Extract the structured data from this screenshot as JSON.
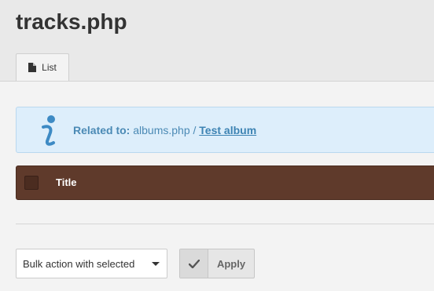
{
  "page": {
    "title": "tracks.php"
  },
  "tabs": [
    {
      "label": "List",
      "icon": "document-icon",
      "active": true
    }
  ],
  "info": {
    "label": "Related to:",
    "parent_file": "albums.php",
    "separator": "/",
    "parent_link": "Test album",
    "icon": "info-icon",
    "color": "#4b8ab5"
  },
  "table": {
    "columns": [
      "Title"
    ],
    "header_color": "#5f3a2b"
  },
  "bulk": {
    "selected": "Bulk action with selected",
    "apply_label": "Apply",
    "apply_icon": "checkmark-icon"
  }
}
